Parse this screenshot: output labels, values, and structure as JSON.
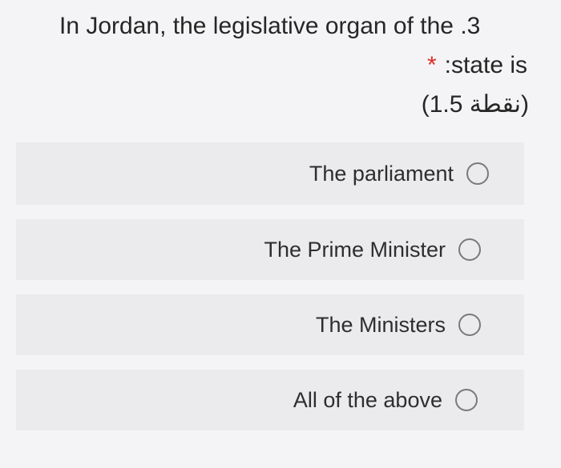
{
  "question": {
    "line1": "In Jordan, the legislative organ of the .3",
    "line2_text": ":state is",
    "line2_asterisk": "*",
    "line3": "(نقطة 1.5)"
  },
  "options": [
    {
      "label": "The parliament"
    },
    {
      "label": "The Prime Minister"
    },
    {
      "label": "The Ministers"
    },
    {
      "label": "All of the above"
    }
  ],
  "colors": {
    "background": "#f4f4f6",
    "option_background": "#ebebee",
    "asterisk": "#d93025",
    "radio_border": "#7a7a7e"
  }
}
